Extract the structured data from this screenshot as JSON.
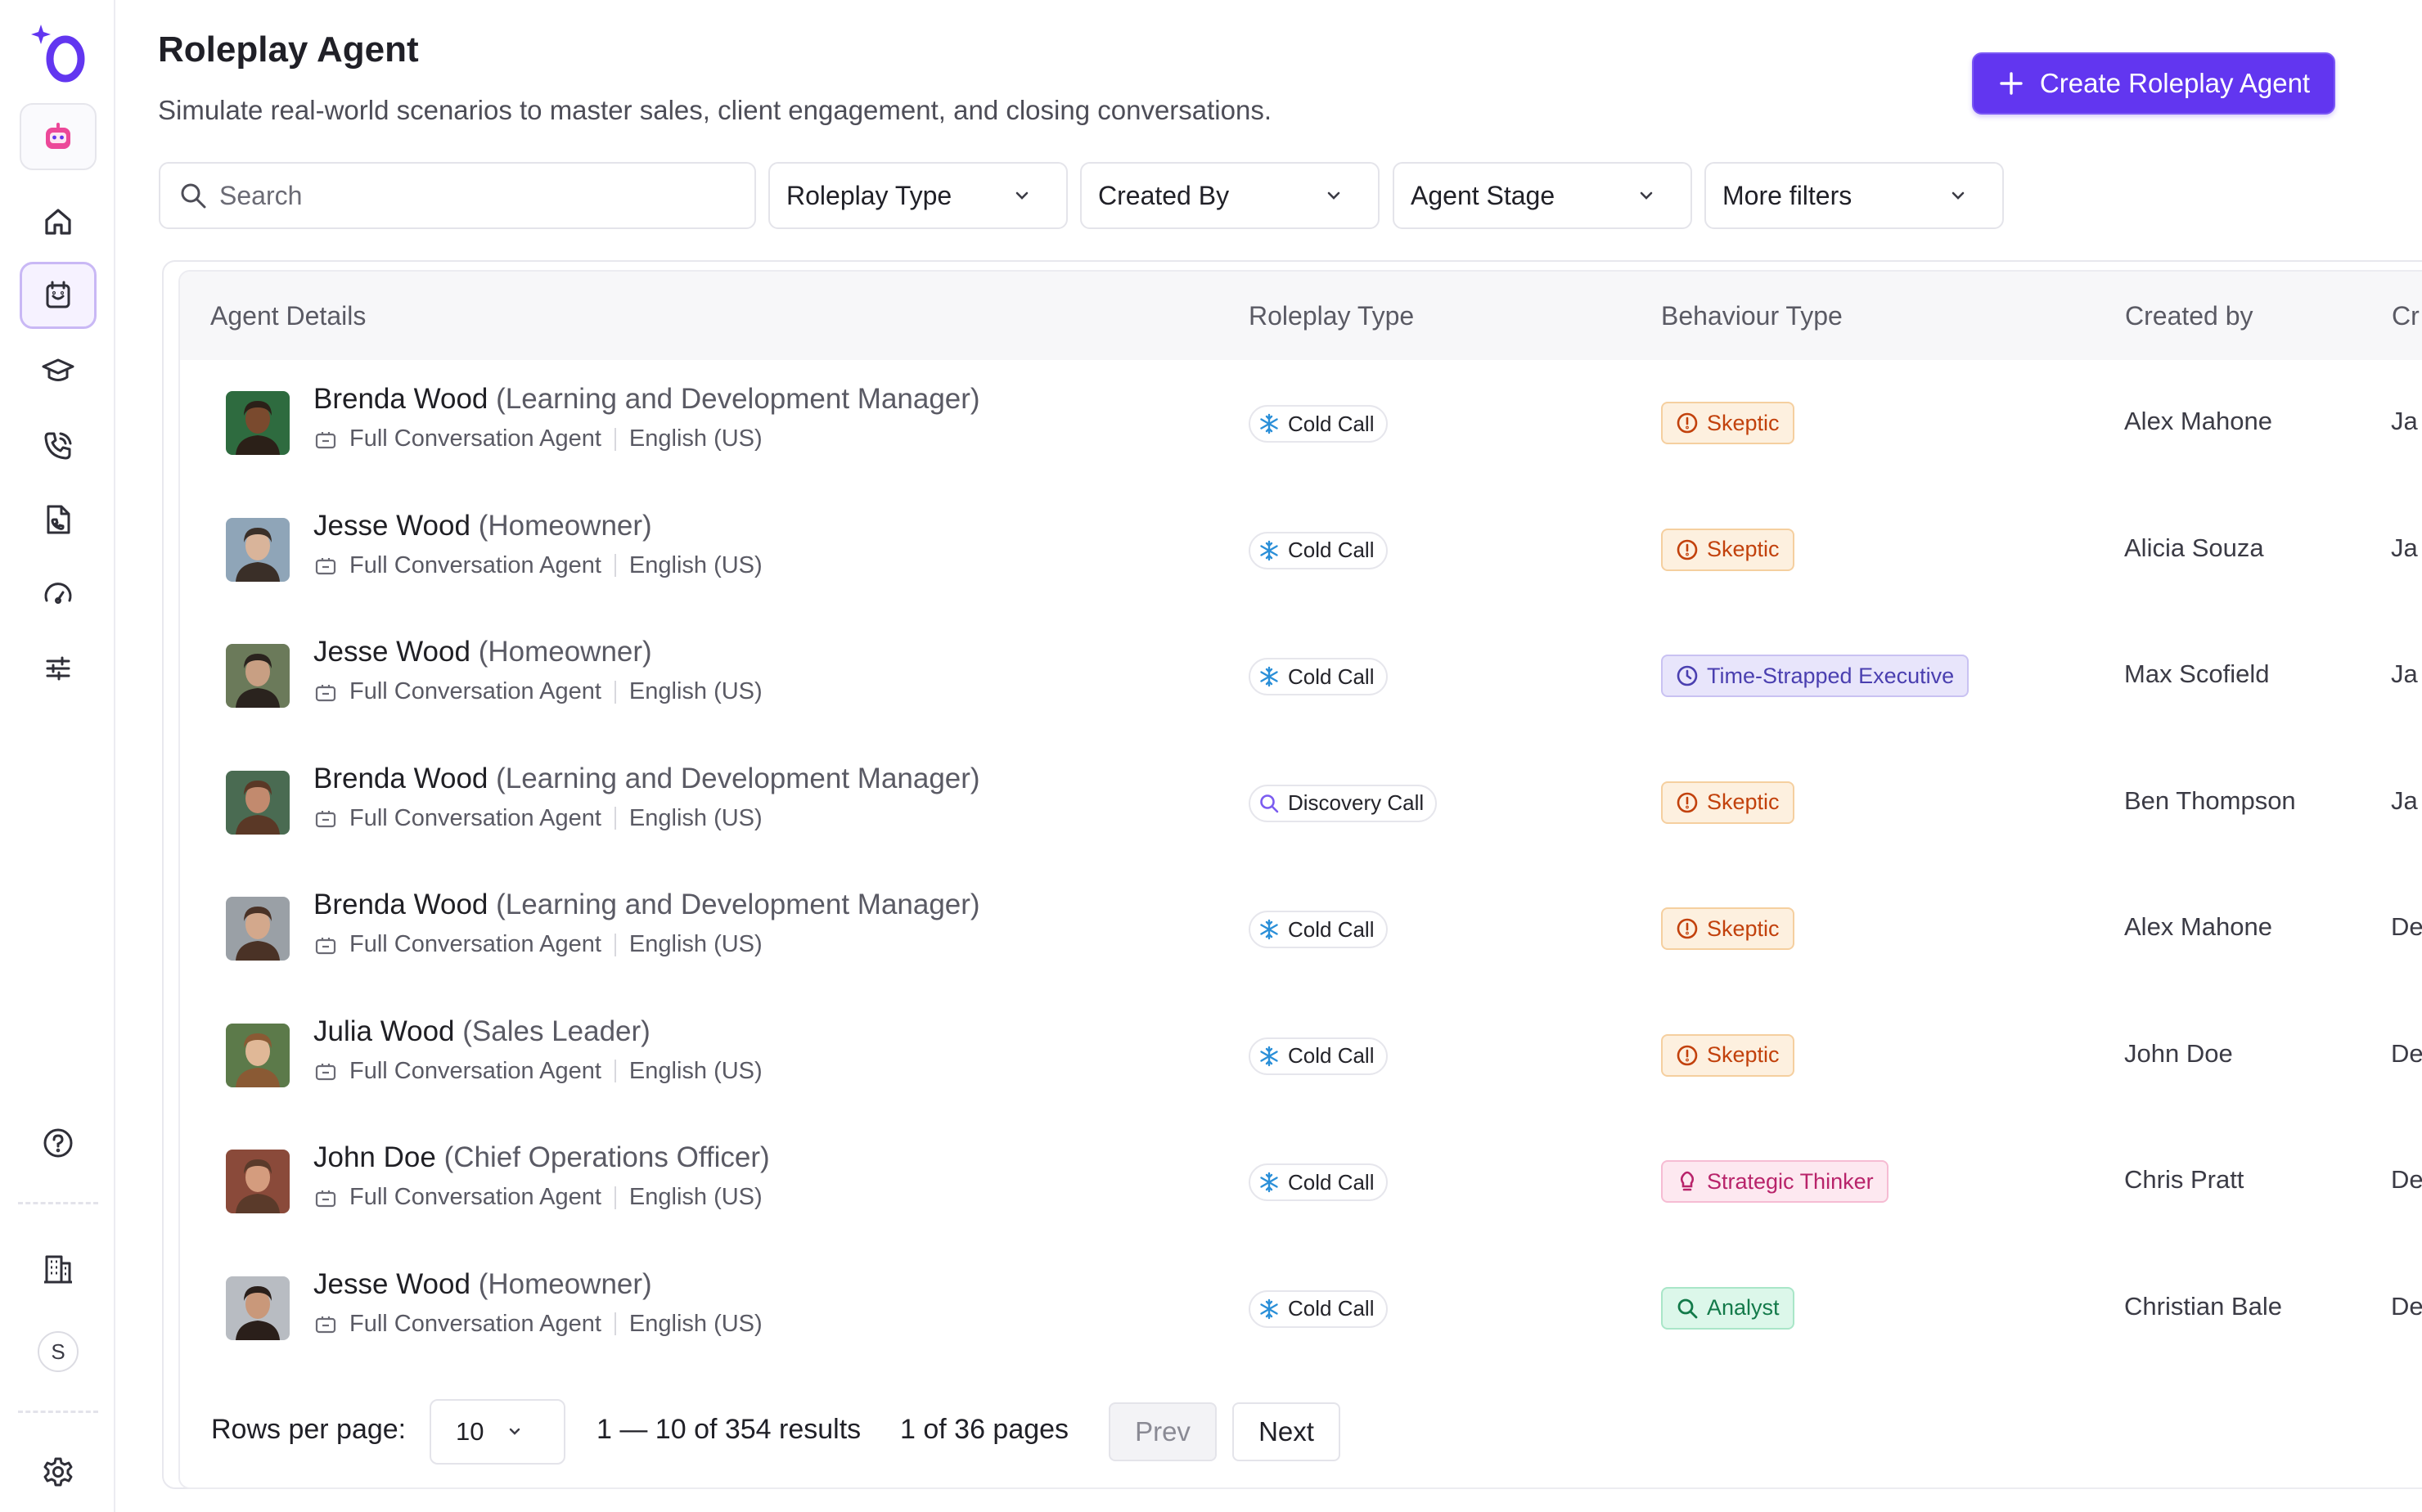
{
  "page": {
    "title": "Roleplay Agent",
    "subtitle": "Simulate real-world scenarios to master sales, client engagement, and closing conversations.",
    "create_button": "Create Roleplay Agent"
  },
  "sidebar": {
    "items": [
      {
        "icon": "bot-icon"
      },
      {
        "icon": "home-icon"
      },
      {
        "icon": "calendar-icon",
        "active": true
      },
      {
        "icon": "graduation-cap-icon"
      },
      {
        "icon": "phone-call-icon"
      },
      {
        "icon": "document-call-icon"
      },
      {
        "icon": "speedometer-icon"
      },
      {
        "icon": "sliders-icon"
      }
    ],
    "bottom": [
      {
        "icon": "help-icon"
      },
      {
        "icon": "building-icon"
      },
      {
        "icon": "settings-icon"
      }
    ],
    "user_initial": "S"
  },
  "filters": {
    "search_placeholder": "Search",
    "roleplay_type": "Roleplay Type",
    "created_by": "Created By",
    "agent_stage": "Agent Stage",
    "more_filters": "More filters"
  },
  "table": {
    "columns": {
      "details": "Agent Details",
      "roleplay_type": "Roleplay Type",
      "behaviour_type": "Behaviour Type",
      "created_by": "Created by",
      "created_on": "Cr"
    },
    "rows": [
      {
        "name": "Brenda Wood",
        "role": "(Learning and Development Manager)",
        "agent_type": "Full Conversation Agent",
        "language": "English (US)",
        "roleplay_type": "Cold Call",
        "behaviour": "Skeptic",
        "creator": "Alex Mahone",
        "created_on": "Ja"
      },
      {
        "name": "Jesse Wood",
        "role": "(Homeowner)",
        "agent_type": "Full Conversation Agent",
        "language": "English (US)",
        "roleplay_type": "Cold Call",
        "behaviour": "Skeptic",
        "creator": "Alicia Souza",
        "created_on": "Ja"
      },
      {
        "name": "Jesse Wood",
        "role": "(Homeowner)",
        "agent_type": "Full Conversation Agent",
        "language": "English (US)",
        "roleplay_type": "Cold Call",
        "behaviour": "Time-Strapped Executive",
        "creator": "Max Scofield",
        "created_on": "Ja"
      },
      {
        "name": "Brenda Wood",
        "role": "(Learning and Development Manager)",
        "agent_type": "Full Conversation Agent",
        "language": "English (US)",
        "roleplay_type": "Discovery Call",
        "behaviour": "Skeptic",
        "creator": "Ben Thompson",
        "created_on": "Ja"
      },
      {
        "name": "Brenda Wood",
        "role": "(Learning and Development Manager)",
        "agent_type": "Full Conversation Agent",
        "language": "English (US)",
        "roleplay_type": "Cold Call",
        "behaviour": "Skeptic",
        "creator": "Alex Mahone",
        "created_on": "De"
      },
      {
        "name": "Julia Wood",
        "role": "(Sales Leader)",
        "agent_type": "Full Conversation Agent",
        "language": "English (US)",
        "roleplay_type": "Cold Call",
        "behaviour": "Skeptic",
        "creator": "John Doe",
        "created_on": "De"
      },
      {
        "name": "John Doe",
        "role": "(Chief Operations Officer)",
        "agent_type": "Full Conversation Agent",
        "language": "English (US)",
        "roleplay_type": "Cold Call",
        "behaviour": "Strategic Thinker",
        "creator": "Chris Pratt",
        "created_on": "De"
      },
      {
        "name": "Jesse Wood",
        "role": "(Homeowner)",
        "agent_type": "Full Conversation Agent",
        "language": "English (US)",
        "roleplay_type": "Cold Call",
        "behaviour": "Analyst",
        "creator": "Christian Bale",
        "created_on": "De"
      }
    ]
  },
  "pagination": {
    "rows_per_page_label": "Rows per page:",
    "rows_per_page": "10",
    "range": "1 — 10 of 354 results",
    "pages": "1 of 36 pages",
    "prev": "Prev",
    "next": "Next"
  },
  "colors": {
    "accent": "#6236f0",
    "skeptic_bg": "#fdf0df",
    "skeptic_fg": "#c2410c",
    "time_bg": "#e8e5fb",
    "time_fg": "#4a3fb0",
    "strategic_bg": "#fde8f0",
    "strategic_fg": "#b8236a",
    "analyst_bg": "#dcf7ea",
    "analyst_fg": "#137a4a",
    "cold_call_icon": "#2a8fd8",
    "discovery_icon": "#7b5cf0"
  }
}
